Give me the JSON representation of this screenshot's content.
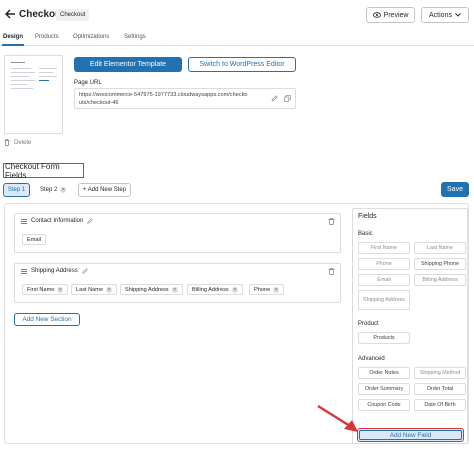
{
  "header": {
    "title": "Checkout",
    "badge": "Checkout",
    "preview_label": "Preview",
    "actions_label": "Actions"
  },
  "tabs": [
    {
      "label": "Design",
      "active": true
    },
    {
      "label": "Products"
    },
    {
      "label": "Optimizations"
    },
    {
      "label": "Settings"
    }
  ],
  "design": {
    "delete_label": "Delete",
    "edit_template_label": "Edit Elementor Template",
    "switch_editor_label": "Switch to WordPress Editor",
    "page_url_label": "Page URL",
    "page_url_line1": "https://woocommerce-547975-1977733.cloudwaysapps.com/checko",
    "page_url_line2": "uts/checkout-46"
  },
  "form": {
    "title": "Checkout Form Fields",
    "steps": [
      {
        "label": "Step 1",
        "active": true
      },
      {
        "label": "Step 2"
      }
    ],
    "add_step_label": "+ Add New Step",
    "save_label": "Save",
    "sections": [
      {
        "title": "Contact Information",
        "fields": [
          "Email"
        ]
      },
      {
        "title": "Shipping Address",
        "fields": [
          "First Name",
          "Last Name",
          "Shipping Address",
          "Billing Address",
          "Phone"
        ]
      }
    ],
    "add_section_label": "Add New Section"
  },
  "fields_panel": {
    "title": "Fields",
    "basic_label": "Basic",
    "basic": [
      "First Name",
      "Last Name",
      "Phone",
      "Shipping Phone",
      "Email",
      "Billing Address",
      "Shipping Address"
    ],
    "product_label": "Product",
    "product": [
      "Products"
    ],
    "advanced_label": "Advanced",
    "advanced": [
      "Order Notes",
      "Shipping Method",
      "Order Summary",
      "Order Total",
      "Coupon Code",
      "Date Of Birth"
    ],
    "add_field_label": "Add New Field"
  },
  "colors": {
    "accent": "#2271b1",
    "highlight": "#d63638"
  }
}
